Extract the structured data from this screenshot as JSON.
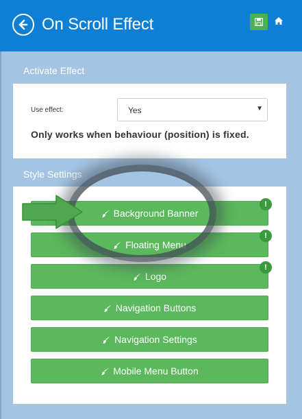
{
  "header": {
    "title": "On Scroll Effect"
  },
  "activate": {
    "section_title": "Activate Effect",
    "use_effect_label": "Use effect:",
    "use_effect_value": "Yes",
    "note": "Only works when behaviour (position) is fixed."
  },
  "style": {
    "section_title": "Style Settings",
    "buttons": [
      {
        "label": "Background Banner",
        "badge": "!"
      },
      {
        "label": "Floating Menu",
        "badge": "!"
      },
      {
        "label": "Logo",
        "badge": "!"
      },
      {
        "label": "Navigation Buttons"
      },
      {
        "label": "Navigation Settings"
      },
      {
        "label": "Mobile Menu Button"
      }
    ]
  },
  "colors": {
    "header": "#0f7fd6",
    "background": "#a4c4e2",
    "button_green": "#5cb85c",
    "badge_green": "#3b9a3b",
    "arrow_green": "#4fa84f"
  },
  "icons": {
    "back": "back-arrow-circle-icon",
    "save": "floppy-disk-icon",
    "home": "home-icon",
    "button": "paint-brush-icon",
    "badge": "exclamation-icon",
    "pointer": "green-pointer-arrow"
  }
}
